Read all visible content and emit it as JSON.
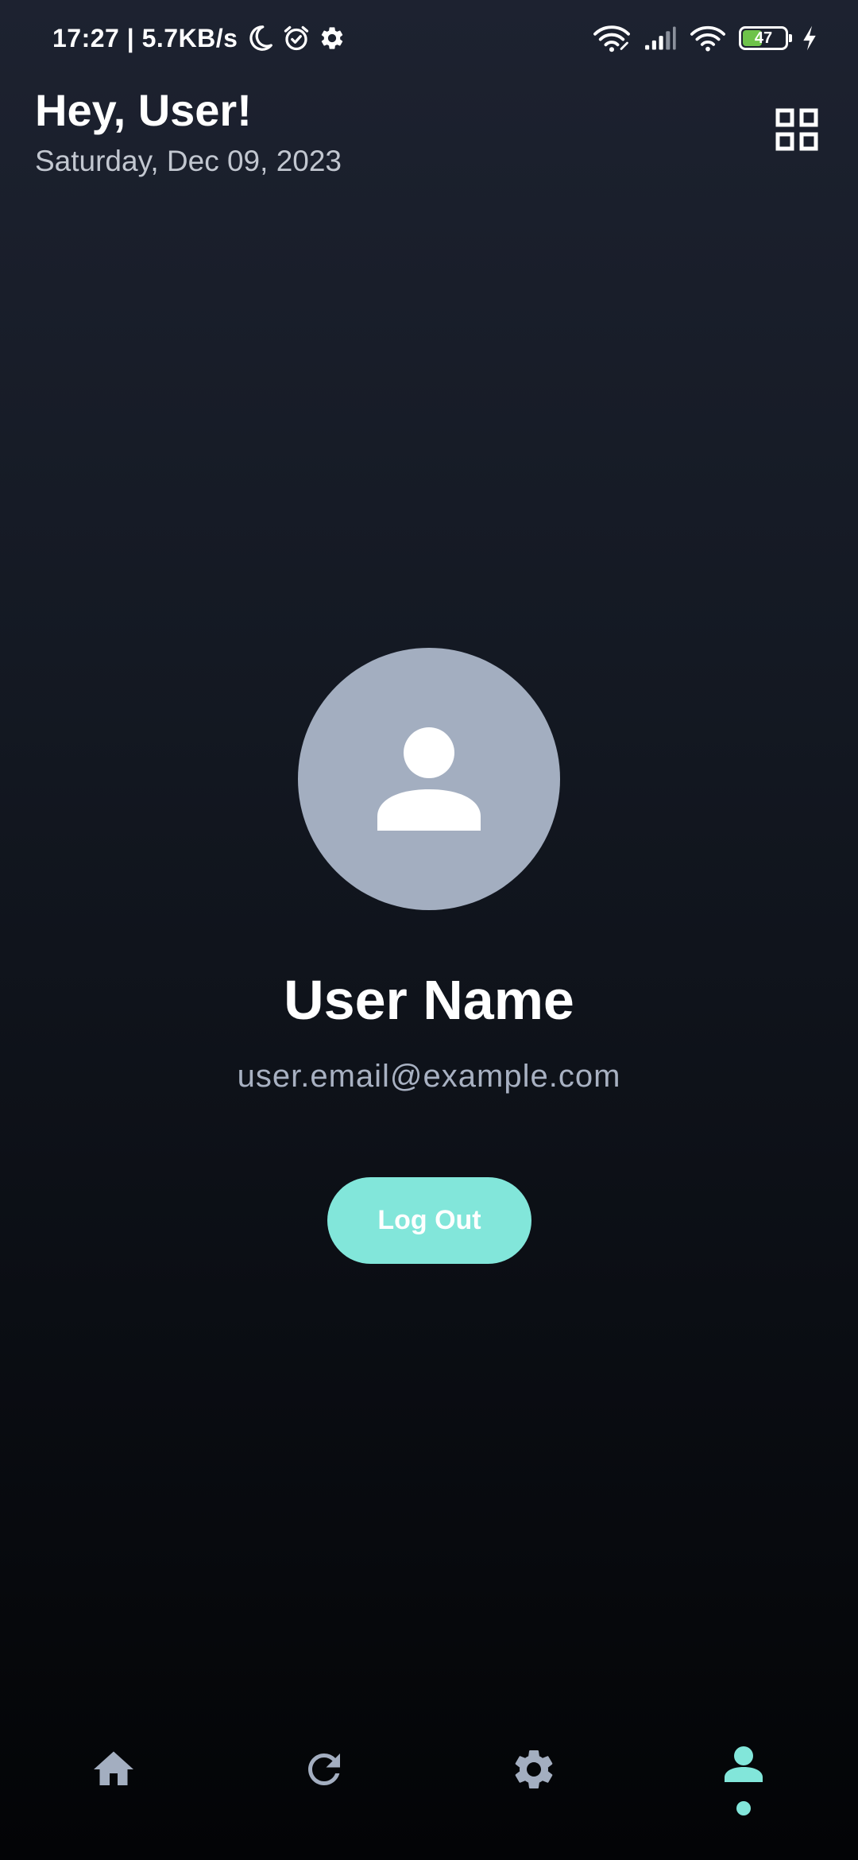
{
  "status_bar": {
    "time_speed": "17:27 | 5.7KB/s",
    "battery_level": "47",
    "battery_fraction": 0.47,
    "icons": [
      "moon-icon",
      "alarm-icon",
      "gear-icon",
      "wifi-icon",
      "signal-icon",
      "wifi-icon",
      "battery-icon",
      "charging-icon"
    ]
  },
  "header": {
    "greeting": "Hey, User!",
    "date": "Saturday, Dec 09, 2023",
    "grid_icon": "grid-icon"
  },
  "profile": {
    "avatar_icon": "person-icon",
    "name": "User Name",
    "email": "user.email@example.com",
    "logout_label": "Log Out"
  },
  "bottom_nav": {
    "items": [
      {
        "icon": "home-icon",
        "active": false
      },
      {
        "icon": "refresh-icon",
        "active": false
      },
      {
        "icon": "settings-icon",
        "active": false
      },
      {
        "icon": "profile-icon",
        "active": true
      }
    ]
  },
  "colors": {
    "accent": "#82e6da",
    "avatar_bg": "#a3aec0",
    "nav_inactive": "#a3aec0",
    "battery_fill": "#6ec34a"
  }
}
